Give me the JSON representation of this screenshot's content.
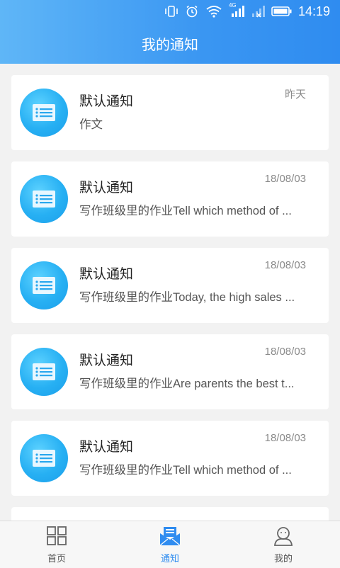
{
  "status_bar": {
    "time": "14:19",
    "icons": [
      "vibrate-icon",
      "alarm-icon",
      "wifi-icon",
      "signal-4g-icon",
      "signal-empty-icon",
      "battery-icon"
    ],
    "network_label": "4G"
  },
  "header": {
    "title": "我的通知"
  },
  "notifications": [
    {
      "title": "默认通知",
      "date": "昨天",
      "body": "作文"
    },
    {
      "title": "默认通知",
      "date": "18/08/03",
      "body": "写作班级里的作业Tell which method of ..."
    },
    {
      "title": "默认通知",
      "date": "18/08/03",
      "body": "写作班级里的作业Today, the high sales ..."
    },
    {
      "title": "默认通知",
      "date": "18/08/03",
      "body": "写作班级里的作业Are parents the best t..."
    },
    {
      "title": "默认通知",
      "date": "18/08/03",
      "body": "写作班级里的作业Tell which method of ..."
    }
  ],
  "tabs": [
    {
      "label": "首页",
      "icon": "grid-icon",
      "active": false
    },
    {
      "label": "通知",
      "icon": "mail-notice-icon",
      "active": true
    },
    {
      "label": "我的",
      "icon": "person-icon",
      "active": false
    }
  ],
  "colors": {
    "accent": "#2f8cf0",
    "header_start": "#5fb6f7",
    "header_end": "#2f8cf0"
  }
}
